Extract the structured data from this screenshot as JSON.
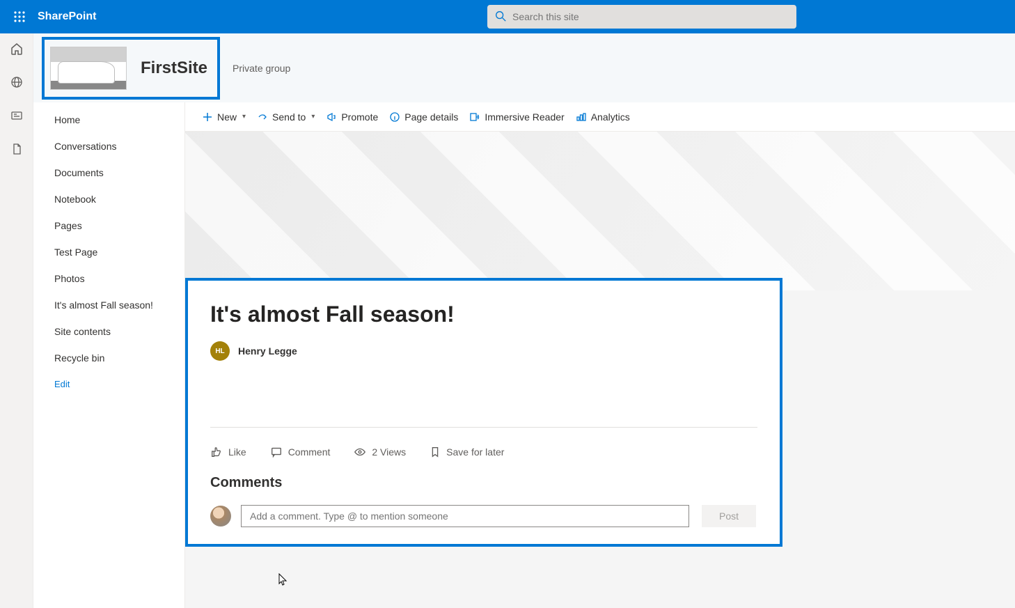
{
  "suite_bar": {
    "app_name": "SharePoint",
    "search_placeholder": "Search this site"
  },
  "site_header": {
    "title": "FirstSite",
    "privacy": "Private group",
    "logo_alt": "car-site-logo"
  },
  "left_nav": {
    "items": [
      {
        "label": "Home"
      },
      {
        "label": "Conversations"
      },
      {
        "label": "Documents"
      },
      {
        "label": "Notebook"
      },
      {
        "label": "Pages"
      },
      {
        "label": "Test Page"
      },
      {
        "label": "Photos"
      },
      {
        "label": "It's almost Fall season!"
      },
      {
        "label": "Site contents"
      },
      {
        "label": "Recycle bin"
      }
    ],
    "edit_label": "Edit"
  },
  "command_bar": {
    "new": "New",
    "send_to": "Send to",
    "promote": "Promote",
    "page_details": "Page details",
    "immersive_reader": "Immersive Reader",
    "analytics": "Analytics"
  },
  "article": {
    "title": "It's almost Fall season!",
    "author_initials": "HL",
    "author_name": "Henry Legge",
    "social": {
      "like": "Like",
      "comment": "Comment",
      "views": "2 Views",
      "save": "Save for later"
    },
    "comments_heading": "Comments",
    "comment_placeholder": "Add a comment. Type @ to mention someone",
    "post_label": "Post"
  }
}
